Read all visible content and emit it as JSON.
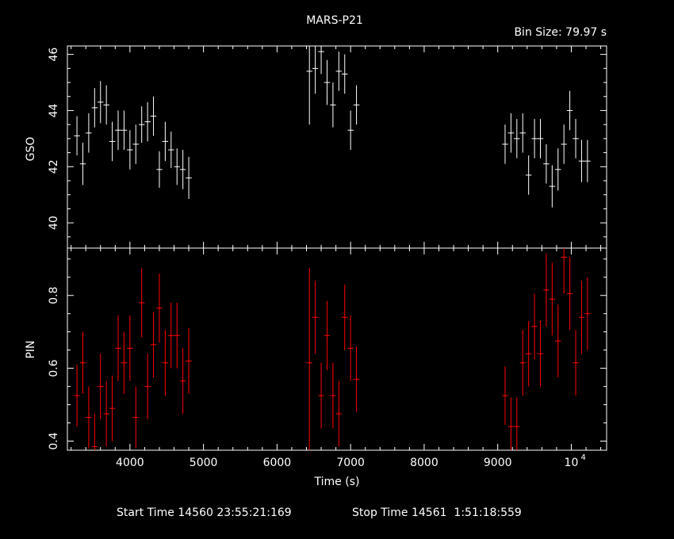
{
  "chart_data": {
    "type": "scatter",
    "title": "MARS-P21",
    "annotation": "Bin Size: 79.97 s",
    "footer": {
      "start": "Start Time 14560 23:55:21:169",
      "stop": "Stop Time 14561  1:51:18:559"
    },
    "xlabel": "Time (s)",
    "xlim": [
      3150,
      10480
    ],
    "x_ticks": [
      "4000",
      "5000",
      "6000",
      "7000",
      "8000",
      "9000",
      "10"
    ],
    "x_tick_exponent": "4",
    "colors": {
      "background": "#000000",
      "axes": "#ffffff",
      "gso": "#ffffff",
      "pin": "#ff0000"
    },
    "panels": [
      {
        "ylabel": "GSO",
        "ylim": [
          39.1,
          46.3
        ],
        "y_ticks": [
          40,
          42,
          44,
          46
        ],
        "series": [
          {
            "color": "#ffffff",
            "x": [
              3280,
              3360,
              3440,
              3520,
              3600,
              3680,
              3760,
              3840,
              3920,
              4000,
              4080,
              4160,
              4240,
              4320,
              4400,
              4480,
              4560,
              4640,
              4720,
              4800,
              6440,
              6520,
              6600,
              6680,
              6760,
              6840,
              6920,
              7000,
              7080,
              9100,
              9180,
              9260,
              9340,
              9420,
              9500,
              9580,
              9660,
              9740,
              9820,
              9900,
              9980,
              10060,
              10140,
              10220
            ],
            "y": [
              43.1,
              42.1,
              43.2,
              44.1,
              44.3,
              44.2,
              42.9,
              43.3,
              43.3,
              42.6,
              42.8,
              43.5,
              43.6,
              43.8,
              41.9,
              42.9,
              42.6,
              42.0,
              41.9,
              41.6,
              45.4,
              45.5,
              46.1,
              45.0,
              44.2,
              45.4,
              45.3,
              43.3,
              44.2,
              42.8,
              43.2,
              43.0,
              43.2,
              41.7,
              43.0,
              43.0,
              42.1,
              41.3,
              41.9,
              42.8,
              44.0,
              43.0,
              42.2,
              42.2
            ],
            "yerr": [
              0.7,
              0.75,
              0.7,
              0.7,
              0.75,
              0.7,
              0.7,
              0.7,
              0.7,
              0.7,
              0.7,
              0.65,
              0.7,
              0.7,
              0.65,
              0.7,
              0.65,
              0.65,
              0.7,
              0.75,
              1.9,
              0.9,
              0.8,
              0.8,
              0.8,
              0.7,
              0.7,
              0.7,
              0.7,
              0.7,
              0.7,
              0.7,
              0.7,
              0.7,
              0.7,
              0.7,
              0.7,
              0.75,
              0.75,
              0.7,
              0.7,
              0.7,
              0.75,
              0.75
            ]
          }
        ]
      },
      {
        "ylabel": "PIN",
        "ylim": [
          0.375,
          0.93
        ],
        "y_ticks": [
          "0.4",
          "0.6",
          "0.8"
        ],
        "series": [
          {
            "color": "#ff0000",
            "x": [
              3280,
              3360,
              3440,
              3520,
              3600,
              3680,
              3760,
              3840,
              3920,
              4000,
              4080,
              4160,
              4240,
              4320,
              4400,
              4480,
              4560,
              4640,
              4720,
              4800,
              6440,
              6520,
              6600,
              6680,
              6760,
              6840,
              6920,
              7000,
              7080,
              9100,
              9180,
              9260,
              9340,
              9420,
              9500,
              9580,
              9660,
              9740,
              9820,
              9900,
              9980,
              10060,
              10140,
              10220
            ],
            "y": [
              0.525,
              0.615,
              0.465,
              0.385,
              0.55,
              0.475,
              0.49,
              0.655,
              0.615,
              0.655,
              0.465,
              0.78,
              0.55,
              0.665,
              0.765,
              0.615,
              0.69,
              0.69,
              0.565,
              0.62,
              0.615,
              0.74,
              0.525,
              0.69,
              0.525,
              0.475,
              0.74,
              0.655,
              0.57,
              0.525,
              0.44,
              0.44,
              0.615,
              0.64,
              0.715,
              0.64,
              0.815,
              0.79,
              0.675,
              0.905,
              0.805,
              0.615,
              0.74,
              0.75,
              0.82
            ],
            "yerr": [
              0.085,
              0.085,
              0.085,
              0.09,
              0.09,
              0.09,
              0.09,
              0.09,
              0.085,
              0.09,
              0.085,
              0.095,
              0.09,
              0.09,
              0.095,
              0.09,
              0.09,
              0.09,
              0.09,
              0.09,
              0.26,
              0.1,
              0.09,
              0.095,
              0.09,
              0.09,
              0.09,
              0.09,
              0.09,
              0.08,
              0.08,
              0.08,
              0.09,
              0.09,
              0.09,
              0.09,
              0.1,
              0.1,
              0.1,
              0.1,
              0.1,
              0.09,
              0.1,
              0.1,
              0.1
            ]
          }
        ]
      }
    ]
  }
}
